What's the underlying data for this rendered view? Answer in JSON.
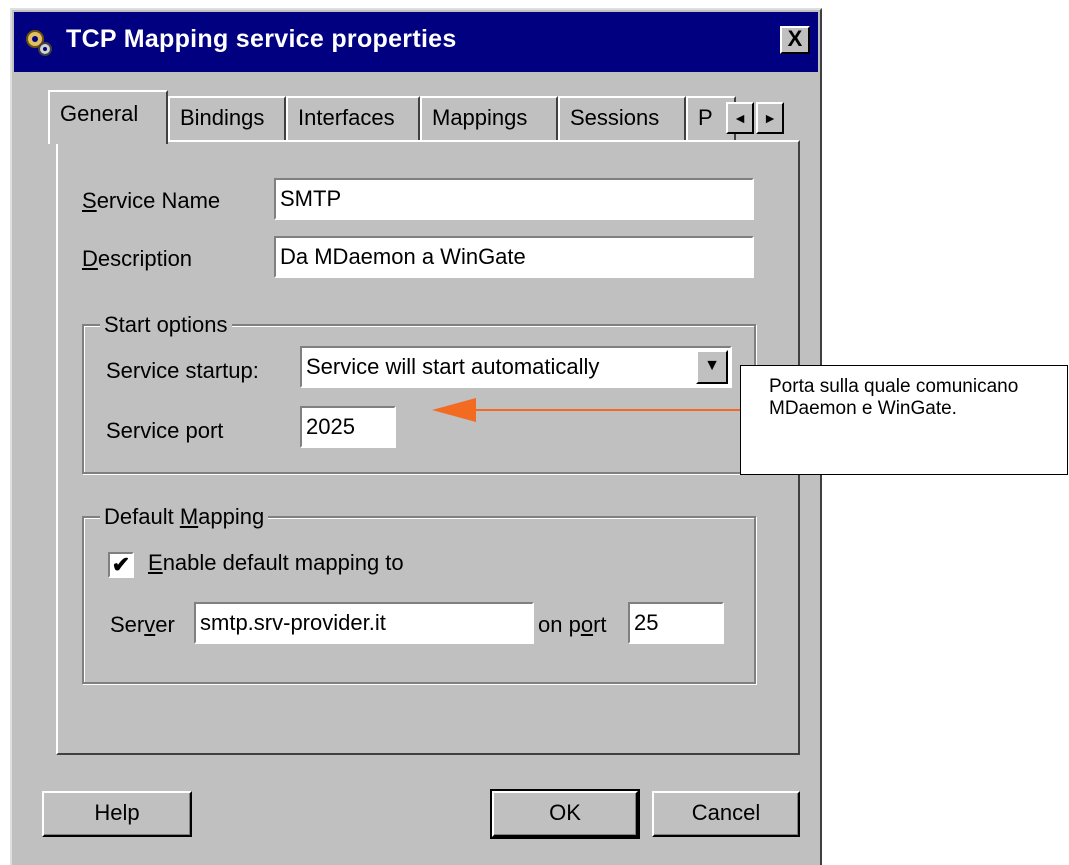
{
  "window": {
    "title": "TCP Mapping service properties",
    "close_label": "X"
  },
  "tabs": [
    {
      "label": "General",
      "active": true
    },
    {
      "label": "Bindings"
    },
    {
      "label": "Interfaces"
    },
    {
      "label": "Mappings"
    },
    {
      "label": "Sessions"
    },
    {
      "label": "P"
    }
  ],
  "tab_scroll": {
    "left": "◄",
    "right": "►"
  },
  "general": {
    "service_name": {
      "label_accel": "S",
      "label_rest": "ervice Name",
      "value": "SMTP"
    },
    "description": {
      "label_accel": "D",
      "label_rest": "escription",
      "value": "Da MDaemon a WinGate"
    }
  },
  "start_options": {
    "title": "Start options",
    "startup_label": "Service startup:",
    "startup_value": "Service will start automatically",
    "port_label": "Service port",
    "port_value": "2025",
    "dropdown_glyph": "▼"
  },
  "default_mapping": {
    "title_pre": "Default ",
    "title_accel": "M",
    "title_rest": "apping",
    "enable_label_accel": "E",
    "enable_label_rest": "nable default mapping to",
    "enable_checked": true,
    "check_glyph": "✔",
    "server_label_pre": "Ser",
    "server_label_accel": "v",
    "server_label_rest": "er",
    "server_value": "smtp.srv-provider.it",
    "on_port_pre": "on p",
    "on_port_accel": "o",
    "on_port_rest": "rt",
    "port_value": "25"
  },
  "buttons": {
    "help": "Help",
    "ok": "OK",
    "cancel": "Cancel"
  },
  "callout": {
    "text": "Porta sulla quale comunicano MDaemon e WinGate.",
    "arrow_color": "#f26b21"
  },
  "colors": {
    "titlebar": "#000080",
    "face": "#c0c0c0"
  }
}
